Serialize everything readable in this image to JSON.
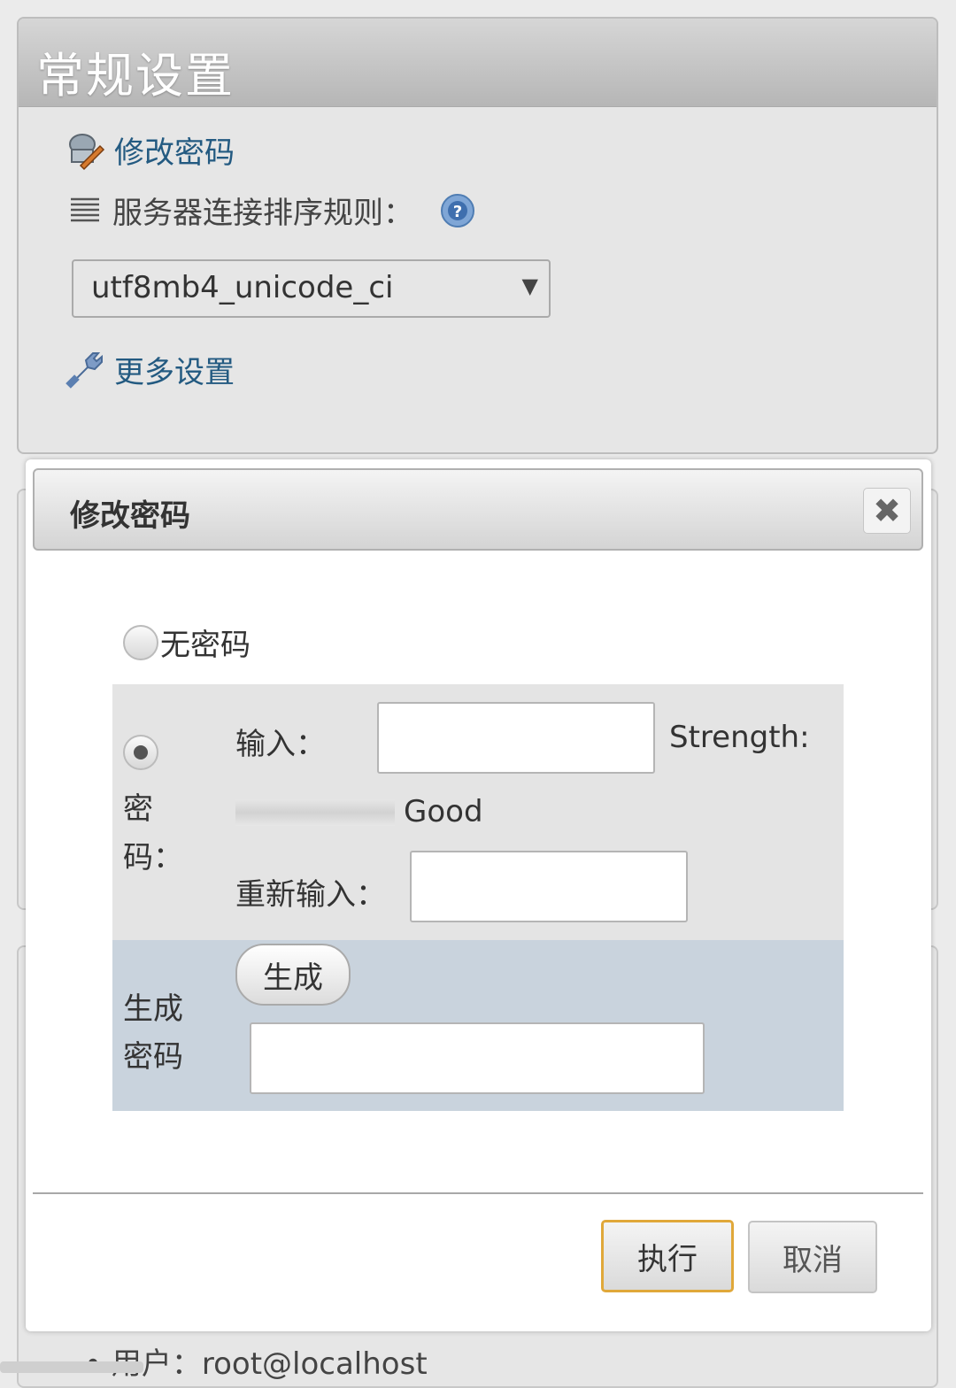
{
  "settings": {
    "title": "常规设置",
    "change_password_link": "修改密码",
    "collation_label": "服务器连接排序规则：",
    "collation_value": "utf8mb4_unicode_ci",
    "more_settings_link": "更多设置"
  },
  "dialog": {
    "title": "修改密码",
    "close_symbol": "✖",
    "no_password_label": "无密码",
    "password_label_line1": "密",
    "password_label_line2": "码：",
    "enter_label": "输入：",
    "strength_label": "Strength:",
    "strength_value": "Good",
    "retype_label": "重新输入：",
    "generate_label_line1": "生成",
    "generate_label_line2": "密码",
    "generate_button": "生成",
    "execute_button": "执行",
    "cancel_button": "取消"
  },
  "footer": {
    "user_text": "• 用户：root@localhost"
  },
  "colors": {
    "link": "#235a81",
    "exec_border": "#e0a83a",
    "generate_area": "#c9d3dd",
    "password_area": "#e4e4e4"
  }
}
